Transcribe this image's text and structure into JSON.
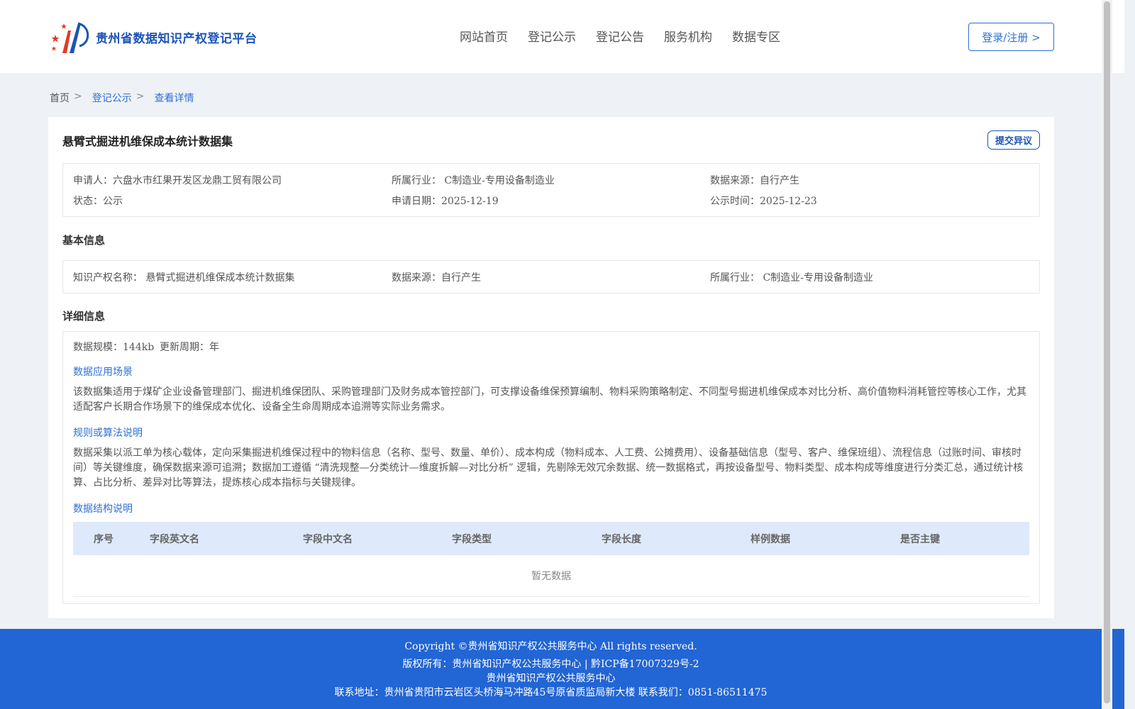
{
  "header": {
    "site_title": "贵州省数据知识产权登记平台",
    "nav": [
      "网站首页",
      "登记公示",
      "登记公告",
      "服务机构",
      "数据专区"
    ],
    "login_label": "登录/注册 >"
  },
  "breadcrumb": {
    "home": "首页",
    "sep": ">",
    "items": [
      "登记公示",
      "查看详情"
    ]
  },
  "dataset": {
    "title": "悬臂式掘进机维保成本统计数据集",
    "objection_label": "提交异议"
  },
  "summary": {
    "applicant_label": "申请人：",
    "applicant": "六盘水市红果开发区龙鼎工贸有限公司",
    "industry_label": "所属行业：",
    "industry": "C制造业-专用设备制造业",
    "source_label": "数据来源：",
    "source": "自行产生",
    "status_label": "状态：",
    "status": "公示",
    "apply_date_label": "申请日期：",
    "apply_date": "2025-12-19",
    "publish_time_label": "公示时间：",
    "publish_time": "2025-12-23"
  },
  "basic": {
    "section_title": "基本信息",
    "ip_name_label": "知识产权名称：",
    "ip_name": "悬臂式掘进机维保成本统计数据集",
    "source_label": "数据来源：",
    "source": "自行产生",
    "industry_label": "所属行业：",
    "industry": "C制造业-专用设备制造业"
  },
  "detail": {
    "section_title": "详细信息",
    "scale_label": "数据规模：",
    "scale": "144kb",
    "cycle_label": "更新周期：",
    "cycle": "年",
    "scenario_title": "数据应用场景",
    "scenario_text": "该数据集适用于煤矿企业设备管理部门、掘进机维保团队、采购管理部门及财务成本管控部门，可支撑设备维保预算编制、物料采购策略制定、不同型号掘进机维保成本对比分析、高价值物料消耗管控等核心工作，尤其适配客户长期合作场景下的维保成本优化、设备全生命周期成本追溯等实际业务需求。",
    "rules_title": "规则或算法说明",
    "rules_text": "数据采集以派工单为核心载体，定向采集掘进机维保过程中的物料信息（名称、型号、数量、单价）、成本构成（物料成本、人工费、公摊费用）、设备基础信息（型号、客户、维保班组）、流程信息（过账时间、审核时间）等关键维度，确保数据来源可追溯；数据加工遵循 “清洗规整—分类统计—维度拆解—对比分析” 逻辑，先剔除无效冗余数据、统一数据格式，再按设备型号、物料类型、成本构成等维度进行分类汇总，通过统计核算、占比分析、差异对比等算法，提炼核心成本指标与关键规律。",
    "structure_title": "数据结构说明",
    "table_headers": [
      "序号",
      "字段英文名",
      "字段中文名",
      "字段类型",
      "字段长度",
      "样例数据",
      "是否主键"
    ],
    "empty_text": "暂无数据"
  },
  "footer": {
    "line1": "Copyright ©贵州省知识产权公共服务中心 All rights reserved.",
    "line2": "版权所有：贵州省知识产权公共服务中心 | 黔ICP备17007329号-2",
    "line3": "贵州省知识产权公共服务中心",
    "line4": "联系地址：贵州省贵阳市云岩区头桥海马冲路45号原省质监局新大楼 联系我们：0851-86511475"
  },
  "colors": {
    "accent": "#2e6fd6",
    "brand": "#1b54b4",
    "footer_bg": "#2265d4",
    "table_head_bg": "#deeafb"
  }
}
